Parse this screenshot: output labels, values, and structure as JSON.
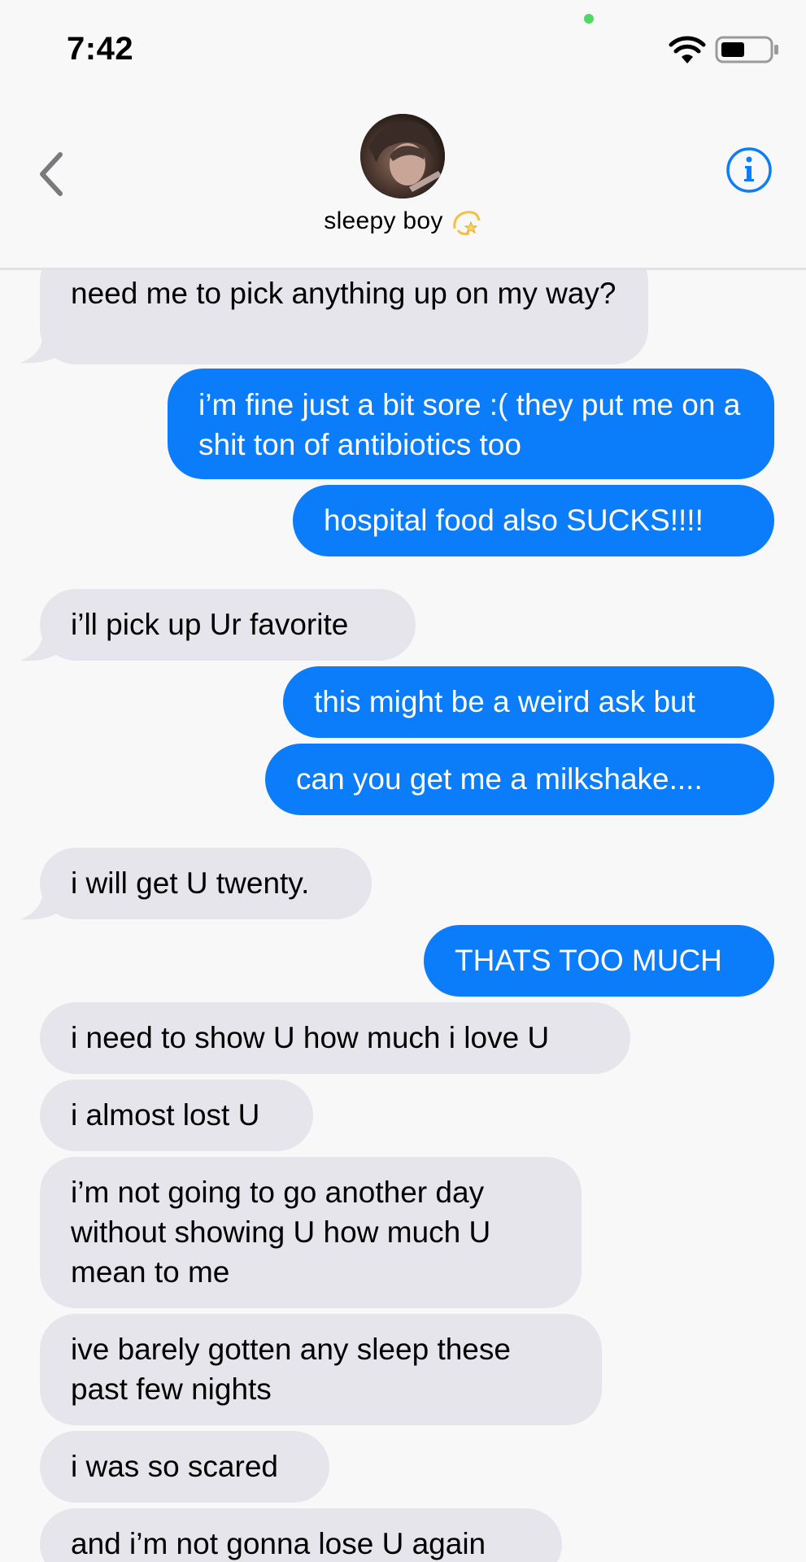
{
  "status": {
    "time": "7:42"
  },
  "contact": {
    "name": "sleepy boy"
  },
  "messages": [
    {
      "from": "them",
      "text": "need me to pick anything up on my way?"
    },
    {
      "from": "me",
      "text": "i’m fine just a bit sore :( they put me on a shit ton of antibiotics too"
    },
    {
      "from": "me",
      "text": "hospital food also SUCKS!!!!"
    },
    {
      "from": "them",
      "text": "i’ll pick up Ur favorite"
    },
    {
      "from": "me",
      "text": "this might be a weird ask but"
    },
    {
      "from": "me",
      "text": "can you get me a milkshake...."
    },
    {
      "from": "them",
      "text": "i will get U twenty."
    },
    {
      "from": "me",
      "text": "THATS TOO MUCH"
    },
    {
      "from": "them",
      "text": "i need to show U how much i love U"
    },
    {
      "from": "them",
      "text": "i almost lost U"
    },
    {
      "from": "them",
      "text": "i’m not going to go another day without showing U how much U mean to me"
    },
    {
      "from": "them",
      "text": "ive barely gotten any sleep these past few nights"
    },
    {
      "from": "them",
      "text": "i was so scared"
    },
    {
      "from": "them",
      "text": "and i’m not gonna lose U again"
    }
  ],
  "colors": {
    "incoming": "#e6e5eb",
    "outgoing": "#0b7dfa",
    "accent": "#0b7dfa"
  }
}
